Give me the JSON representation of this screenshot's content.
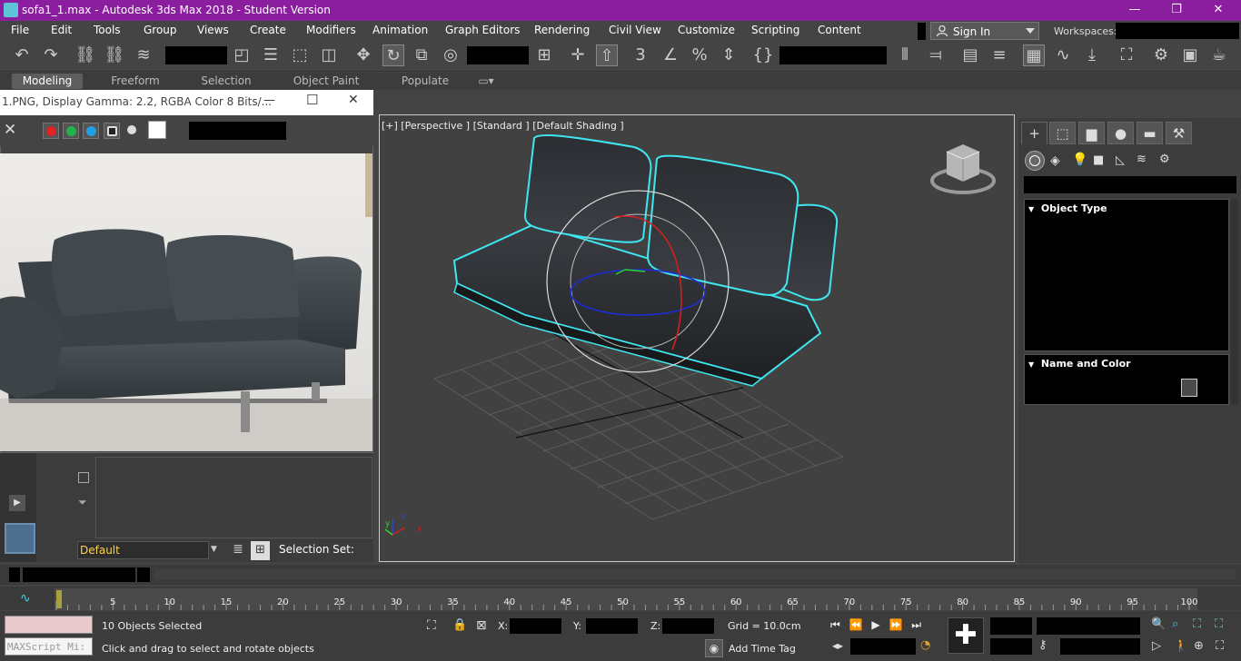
{
  "window": {
    "title": "sofa1_1.max - Autodesk 3ds Max 2018 - Student Version",
    "minimize": "—",
    "maximize": "❐",
    "close": "✕"
  },
  "menu": [
    "File",
    "Edit",
    "Tools",
    "Group",
    "Views",
    "Create",
    "Modifiers",
    "Animation",
    "Graph Editors",
    "Rendering",
    "Civil View",
    "Customize",
    "Scripting",
    "Content"
  ],
  "account": {
    "sign_in": "Sign In",
    "workspaces_label": "Workspaces:"
  },
  "ribbon_tabs": [
    "Modeling",
    "Freeform",
    "Selection",
    "Object Paint",
    "Populate"
  ],
  "image_viewer": {
    "title": "1.PNG, Display Gamma: 2.2, RGBA Color 8 Bits/...",
    "minimize": "—",
    "maximize": "☐",
    "close": "✕"
  },
  "scene": {
    "layer": "Default",
    "selection_set_label": "Selection Set:"
  },
  "viewport": {
    "label": "[+] [Perspective ] [Standard ] [Default Shading ]"
  },
  "command_panel": {
    "rollouts": [
      {
        "title": "Object Type"
      },
      {
        "title": "Name and Color"
      }
    ]
  },
  "timeline": {
    "ticks": [
      "0",
      "5",
      "10",
      "15",
      "20",
      "25",
      "30",
      "35",
      "40",
      "45",
      "50",
      "55",
      "60",
      "65",
      "70",
      "75",
      "80",
      "85",
      "90",
      "95",
      "100"
    ]
  },
  "status": {
    "maxscript_placeholder": "MAXScript Mi:",
    "selected": "10 Objects Selected",
    "prompt": "Click and drag to select and rotate objects",
    "x_label": "X:",
    "y_label": "Y:",
    "z_label": "Z:",
    "grid": "Grid = 10.0cm",
    "add_time_tag": "Add Time Tag"
  },
  "colors": {
    "title_bar": "#8b1e9e",
    "selection_outline": "#3fe6f0",
    "ui_background": "#444444",
    "layer_text": "#ffd24a"
  }
}
